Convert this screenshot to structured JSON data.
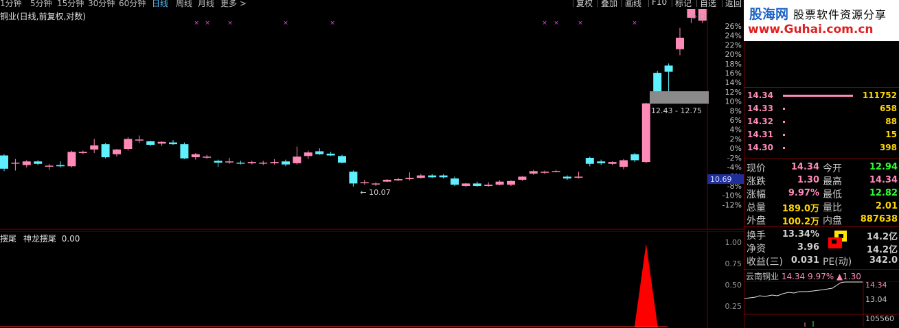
{
  "toolbar": {
    "periods": [
      "1分钟",
      "5分钟",
      "15分钟",
      "30分钟",
      "60分钟",
      "日线",
      "周线",
      "月线",
      "更多 >"
    ],
    "active_period": "日线",
    "buttons": [
      "复权",
      "叠加",
      "画线",
      "F10",
      "标记",
      "自选",
      "返回"
    ]
  },
  "main_chart": {
    "title": "铜业(日线,前复权,对数)",
    "price_high_label": "14.34",
    "price_low_label": "10.07",
    "range_label": "12.43 - 12.75",
    "current_marker": "10.69",
    "percent_ticks": [
      "26%",
      "24%",
      "22%",
      "20%",
      "18%",
      "16%",
      "14%",
      "12%",
      "10%",
      "8%",
      "6%",
      "4%",
      "2%",
      "0%",
      "-2%",
      "-4%",
      "-6%",
      "-8%",
      "-10%",
      "-12%"
    ]
  },
  "sub_chart": {
    "title_prefix": "摆尾",
    "indicator_name": "神龙摆尾",
    "indicator_value": "0.00",
    "ticks": [
      "1.00",
      "0.75",
      "0.50",
      "0.25"
    ]
  },
  "chart_data": {
    "type": "candlestick",
    "title": "铜业(日线,前复权,对数)",
    "colors": {
      "up": "#ff8ab8",
      "down": "#5ff0ff"
    },
    "candles": [
      {
        "o": 10.58,
        "h": 10.6,
        "l": 10.32,
        "c": 10.36
      },
      {
        "o": 10.45,
        "h": 10.52,
        "l": 10.33,
        "c": 10.46
      },
      {
        "o": 10.42,
        "h": 10.5,
        "l": 10.38,
        "c": 10.48
      },
      {
        "o": 10.48,
        "h": 10.5,
        "l": 10.42,
        "c": 10.44
      },
      {
        "o": 10.4,
        "h": 10.44,
        "l": 10.34,
        "c": 10.41
      },
      {
        "o": 10.42,
        "h": 10.48,
        "l": 10.38,
        "c": 10.4
      },
      {
        "o": 10.4,
        "h": 10.66,
        "l": 10.38,
        "c": 10.64
      },
      {
        "o": 10.62,
        "h": 10.66,
        "l": 10.6,
        "c": 10.64
      },
      {
        "o": 10.68,
        "h": 10.86,
        "l": 10.62,
        "c": 10.75
      },
      {
        "o": 10.77,
        "h": 10.79,
        "l": 10.53,
        "c": 10.55
      },
      {
        "o": 10.6,
        "h": 10.69,
        "l": 10.56,
        "c": 10.68
      },
      {
        "o": 10.69,
        "h": 10.89,
        "l": 10.66,
        "c": 10.86
      },
      {
        "o": 10.84,
        "h": 10.92,
        "l": 10.79,
        "c": 10.85
      },
      {
        "o": 10.82,
        "h": 10.83,
        "l": 10.74,
        "c": 10.76
      },
      {
        "o": 10.78,
        "h": 10.82,
        "l": 10.74,
        "c": 10.81
      },
      {
        "o": 10.8,
        "h": 10.84,
        "l": 10.76,
        "c": 10.77
      },
      {
        "o": 10.77,
        "h": 10.8,
        "l": 10.52,
        "c": 10.53
      },
      {
        "o": 10.55,
        "h": 10.62,
        "l": 10.51,
        "c": 10.6
      },
      {
        "o": 10.55,
        "h": 10.59,
        "l": 10.52,
        "c": 10.56
      },
      {
        "o": 10.49,
        "h": 10.51,
        "l": 10.39,
        "c": 10.46
      },
      {
        "o": 10.47,
        "h": 10.54,
        "l": 10.44,
        "c": 10.48
      },
      {
        "o": 10.46,
        "h": 10.49,
        "l": 10.43,
        "c": 10.45
      },
      {
        "o": 10.45,
        "h": 10.49,
        "l": 10.43,
        "c": 10.47
      },
      {
        "o": 10.46,
        "h": 10.49,
        "l": 10.42,
        "c": 10.46
      },
      {
        "o": 10.45,
        "h": 10.52,
        "l": 10.43,
        "c": 10.47
      },
      {
        "o": 10.48,
        "h": 10.51,
        "l": 10.4,
        "c": 10.43
      },
      {
        "o": 10.45,
        "h": 10.73,
        "l": 10.43,
        "c": 10.56
      },
      {
        "o": 10.57,
        "h": 10.66,
        "l": 10.52,
        "c": 10.63
      },
      {
        "o": 10.65,
        "h": 10.7,
        "l": 10.59,
        "c": 10.6
      },
      {
        "o": 10.61,
        "h": 10.64,
        "l": 10.57,
        "c": 10.58
      },
      {
        "o": 10.57,
        "h": 10.59,
        "l": 10.45,
        "c": 10.46
      },
      {
        "o": 10.31,
        "h": 10.33,
        "l": 10.07,
        "c": 10.12
      },
      {
        "o": 10.13,
        "h": 10.18,
        "l": 10.1,
        "c": 10.14
      },
      {
        "o": 10.11,
        "h": 10.14,
        "l": 10.08,
        "c": 10.12
      },
      {
        "o": 10.15,
        "h": 10.19,
        "l": 10.14,
        "c": 10.18
      },
      {
        "o": 10.17,
        "h": 10.21,
        "l": 10.16,
        "c": 10.19
      },
      {
        "o": 10.19,
        "h": 10.3,
        "l": 10.17,
        "c": 10.21
      },
      {
        "o": 10.21,
        "h": 10.27,
        "l": 10.2,
        "c": 10.25
      },
      {
        "o": 10.25,
        "h": 10.27,
        "l": 10.21,
        "c": 10.22
      },
      {
        "o": 10.25,
        "h": 10.27,
        "l": 10.2,
        "c": 10.22
      },
      {
        "o": 10.2,
        "h": 10.23,
        "l": 10.08,
        "c": 10.1
      },
      {
        "o": 10.08,
        "h": 10.13,
        "l": 10.06,
        "c": 10.12
      },
      {
        "o": 10.12,
        "h": 10.15,
        "l": 10.07,
        "c": 10.08
      },
      {
        "o": 10.08,
        "h": 10.14,
        "l": 10.07,
        "c": 10.1
      },
      {
        "o": 10.1,
        "h": 10.17,
        "l": 10.09,
        "c": 10.15
      },
      {
        "o": 10.1,
        "h": 10.17,
        "l": 10.08,
        "c": 10.16
      },
      {
        "o": 10.18,
        "h": 10.24,
        "l": 10.16,
        "c": 10.23
      },
      {
        "o": 10.28,
        "h": 10.34,
        "l": 10.26,
        "c": 10.32
      },
      {
        "o": 10.3,
        "h": 10.33,
        "l": 10.27,
        "c": 10.31
      },
      {
        "o": 10.31,
        "h": 10.34,
        "l": 10.3,
        "c": 10.32
      },
      {
        "o": 10.23,
        "h": 10.25,
        "l": 10.18,
        "c": 10.2
      },
      {
        "o": 10.22,
        "h": 10.31,
        "l": 10.2,
        "c": 10.23
      },
      {
        "o": 10.54,
        "h": 10.56,
        "l": 10.4,
        "c": 10.44
      },
      {
        "o": 10.48,
        "h": 10.51,
        "l": 10.42,
        "c": 10.45
      },
      {
        "o": 10.44,
        "h": 10.48,
        "l": 10.42,
        "c": 10.47
      },
      {
        "o": 10.39,
        "h": 10.52,
        "l": 10.35,
        "c": 10.5
      },
      {
        "o": 10.6,
        "h": 10.62,
        "l": 10.47,
        "c": 10.5
      },
      {
        "o": 10.47,
        "h": 11.5,
        "l": 10.45,
        "c": 11.49
      },
      {
        "o": 12.06,
        "h": 12.1,
        "l": 11.55,
        "c": 11.68
      },
      {
        "o": 12.2,
        "h": 12.24,
        "l": 11.7,
        "c": 12.08
      },
      {
        "o": 12.52,
        "h": 12.95,
        "l": 12.4,
        "c": 12.75
      },
      {
        "o": 13.16,
        "h": 14.4,
        "l": 13.05,
        "c": 13.45
      },
      {
        "o": 13.1,
        "h": 14.34,
        "l": 13.05,
        "c": 14.34
      }
    ],
    "y_axis_percent_ticks": [
      "26%",
      "24%",
      "22%",
      "20%",
      "18%",
      "16%",
      "14%",
      "12%",
      "10%",
      "8%",
      "6%",
      "4%",
      "2%",
      "0%",
      "-2%",
      "-4%",
      "-6%",
      "-8%",
      "-10%",
      "-12%"
    ],
    "markers_x": [
      286,
      302,
      335,
      416,
      484,
      793,
      810,
      845,
      924
    ]
  },
  "sub_chart_data": {
    "spike_center_index": 57,
    "spike_value": 1.0
  },
  "order_book": [
    {
      "price": "14.34",
      "vol": "111752",
      "bar": "full"
    },
    {
      "price": "14.33",
      "vol": "658",
      "bar": "dot"
    },
    {
      "price": "14.32",
      "vol": "88",
      "bar": "dot"
    },
    {
      "price": "14.31",
      "vol": "15",
      "bar": "dot"
    },
    {
      "price": "14.30",
      "vol": "398",
      "bar": "dot"
    }
  ],
  "quote": [
    {
      "l": "现价",
      "v": "14.34",
      "vc": "#ff8ab8",
      "l2": "今开",
      "v2": "12.94",
      "v2c": "#30ff30"
    },
    {
      "l": "涨跌",
      "v": "1.30",
      "vc": "#ff8ab8",
      "l2": "最高",
      "v2": "14.34",
      "v2c": "#ff8ab8"
    },
    {
      "l": "涨幅",
      "v": "9.97%",
      "vc": "#ff8ab8",
      "l2": "最低",
      "v2": "12.82",
      "v2c": "#30ff30"
    },
    {
      "l": "总量",
      "v": "189.0万",
      "vc": "#ffd700",
      "l2": "量比",
      "v2": "2.01",
      "v2c": "#ffd700"
    },
    {
      "l": "外盘",
      "v": "100.2万",
      "vc": "#ffd700",
      "l2": "内盘",
      "v2": "887638",
      "v2c": "#ffd700"
    }
  ],
  "quote2": [
    {
      "l": "换手",
      "v": "13.34%",
      "v2": "14.2亿"
    },
    {
      "l": "净资",
      "v": "3.96",
      "v2": "14.2亿"
    },
    {
      "l": "收益(三)",
      "v": "0.031",
      "l2": "PE(动)",
      "v2": "342.0"
    }
  ],
  "mini": {
    "name": "云南铜业",
    "price": "14.34",
    "pct": "9.97%",
    "chg": "▲1.30",
    "y_top": "14.34",
    "y_mid": "13.04",
    "vol": "105560"
  },
  "logo": {
    "brand1": "股海网",
    "brand2": "股票软件资源分享",
    "url": "www.Guhai.com.cn"
  }
}
